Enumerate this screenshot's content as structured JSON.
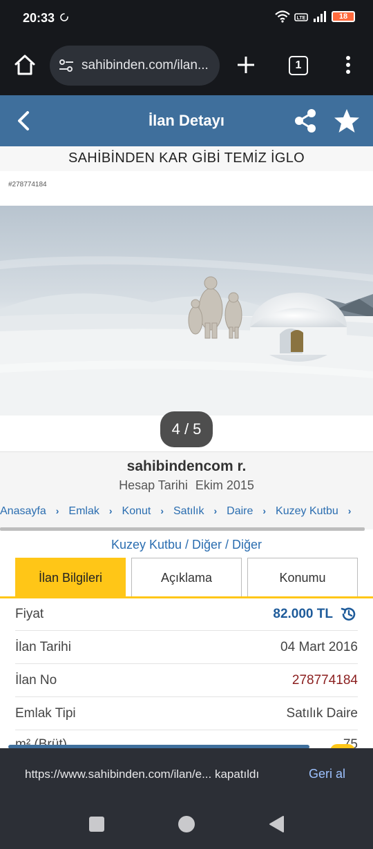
{
  "status_bar": {
    "time": "20:33",
    "battery": "18"
  },
  "browser": {
    "url": "sahibinden.com/ilan...",
    "tab_count": "1"
  },
  "header": {
    "title": "İlan Detayı"
  },
  "listing": {
    "title": "SAHİBİNDEN KAR GİBİ TEMİZ İGLO",
    "listing_no_small": "#278774184",
    "photo_counter": "4 / 5"
  },
  "seller": {
    "name": "sahibindencom r.",
    "since_label": "Hesap Tarihi",
    "since_value": "Ekim 2015"
  },
  "breadcrumb": [
    "Anasayfa",
    "Emlak",
    "Konut",
    "Satılık",
    "Daire",
    "Kuzey Kutbu"
  ],
  "location_path": "Kuzey Kutbu / Diğer / Diğer",
  "tabs": [
    {
      "label": "İlan Bilgileri",
      "active": true
    },
    {
      "label": "Açıklama",
      "active": false
    },
    {
      "label": "Konumu",
      "active": false
    }
  ],
  "info": [
    {
      "label": "Fiyat",
      "value": "82.000 TL"
    },
    {
      "label": "İlan Tarihi",
      "value": "04 Mart 2016"
    },
    {
      "label": "İlan No",
      "value": "278774184"
    },
    {
      "label": "Emlak Tipi",
      "value": "Satılık Daire"
    },
    {
      "label": "m² (Brüt)",
      "value": "75"
    }
  ],
  "snackbar": {
    "text": "https://www.sahibinden.com/ilan/e... kapatıldı",
    "action": "Geri al"
  },
  "colors": {
    "header": "#3f6f9c",
    "accent": "#ffc617",
    "link": "#2a6db0",
    "price": "#1e5b9a"
  },
  "icons": [
    "home-icon",
    "site-settings-icon",
    "plus-icon",
    "tabs-icon",
    "more-vert-icon",
    "back-icon",
    "share-icon",
    "star-icon",
    "history-icon",
    "chevron-right-icon"
  ]
}
